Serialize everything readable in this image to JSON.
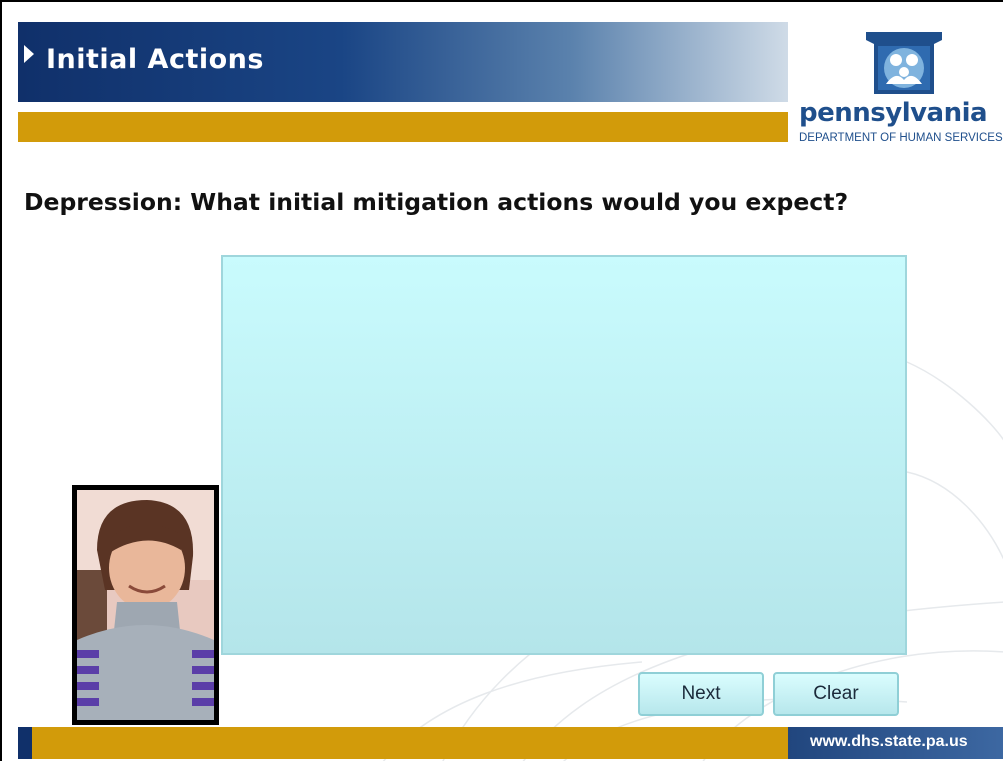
{
  "header": {
    "title": "Initial Actions",
    "accent_color": "#d29b0a",
    "title_bar_color": "#10306a"
  },
  "logo": {
    "name": "pennsylvania",
    "department": "DEPARTMENT OF HUMAN SERVICES",
    "color": "#1f4f8c"
  },
  "question": {
    "text": "Depression: What initial mitigation actions would you expect?"
  },
  "answer": {
    "value": ""
  },
  "buttons": {
    "next_label": "Next",
    "clear_label": "Clear"
  },
  "footer": {
    "url": "www.dhs.state.pa.us"
  }
}
